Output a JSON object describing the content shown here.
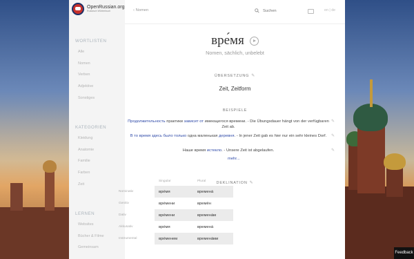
{
  "site": {
    "title": "OpenRussian.org",
    "subtitle": "Russisch Wörterbuch"
  },
  "sidebar": {
    "sections": [
      {
        "title": "WORTLISTEN",
        "items": [
          "Alle",
          "Nomen",
          "Verben",
          "Adjektive",
          "Sonstiges"
        ]
      },
      {
        "title": "KATEGORIEN",
        "items": [
          "Kleidung",
          "Anatomie",
          "Familie",
          "Farben",
          "Zeit"
        ]
      },
      {
        "title": "LERNEN",
        "items": [
          "Websites",
          "Bücher & Filme",
          "Gemeinsam"
        ]
      }
    ]
  },
  "topbar": {
    "back_label": "Nomen",
    "search_placeholder": "Suchen",
    "lang_options": "en | de"
  },
  "entry": {
    "word": "вре́мя",
    "info": "Nomen, sächlich, unbelebt"
  },
  "translation": {
    "title": "ÜBERSETZUNG",
    "text": "Zeit, Zeitform"
  },
  "examples": {
    "title": "BEISPIELE",
    "items": [
      {
        "ru_parts": [
          "Продолжительность",
          " практики ",
          "зависит от",
          " имеющегося времени."
        ],
        "de": "Die Übungsdauer hängt von der verfügbaren Zeit ab."
      },
      {
        "ru_parts": [
          "В то время",
          " здесь было только",
          " одна маленькая ",
          "деревня",
          "."
        ],
        "de": "In jener Zeit gab es hier nur ein sehr kleines Dorf."
      },
      {
        "ru_parts": [
          "Наше время ",
          "истекло",
          "."
        ],
        "de": "Unsere Zeit ist abgelaufen."
      }
    ],
    "more_label": "mehr..."
  },
  "declension": {
    "title": "DEKLINATION",
    "header": {
      "singular": "Singular",
      "plural": "Plural"
    },
    "rows": [
      {
        "case": "Nominativ",
        "singular": "вре́мя",
        "plural": "времена́"
      },
      {
        "case": "Genitiv",
        "singular": "вре́мени",
        "plural": "времён"
      },
      {
        "case": "Dativ",
        "singular": "вре́мени",
        "plural": "времена́м"
      },
      {
        "case": "Akkusativ",
        "singular": "вре́мя",
        "plural": "времена́"
      },
      {
        "case": "Instrumental",
        "singular": "вре́менем",
        "plural": "времена́ми"
      }
    ]
  },
  "feedback_label": "Feedback",
  "icons": {
    "back": "chevron-left-icon",
    "search": "search-icon",
    "keyboard": "keyboard-icon",
    "play": "play-icon",
    "edit": "pencil-icon"
  },
  "colors": {
    "link": "#2f4aa8",
    "sidebar_bg": "#f4f4f4",
    "feedback_bg": "#111111"
  }
}
